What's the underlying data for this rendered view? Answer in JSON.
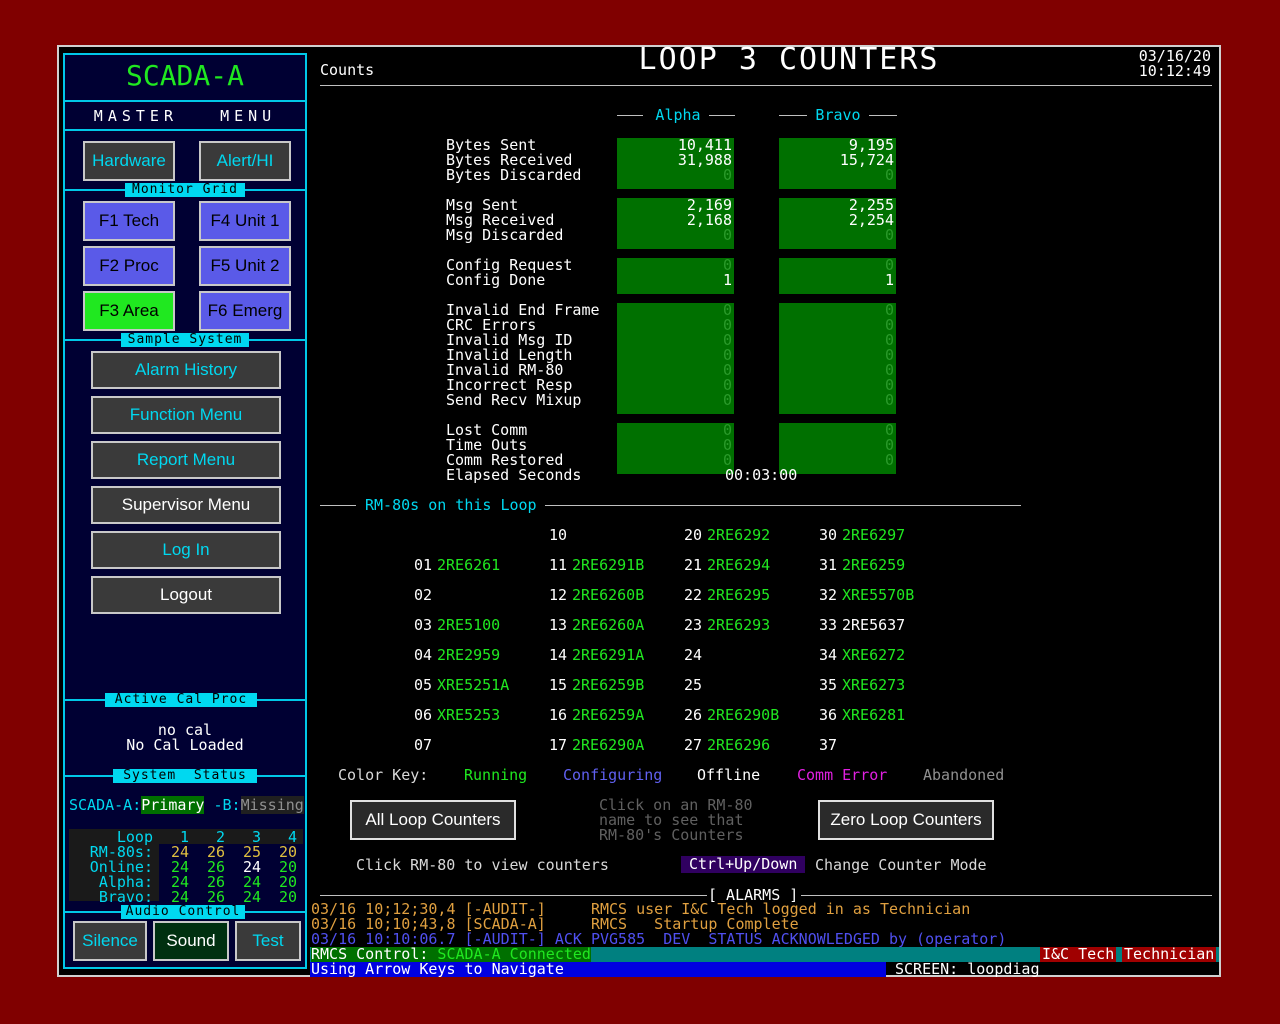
{
  "sidebar": {
    "app_title": "SCADA-A",
    "master_menu": "MASTER   MENU",
    "hardware": "Hardware",
    "alert": "Alert/HI",
    "monitor_grid_label": "Monitor Grid",
    "monitor_buttons": [
      "F1 Tech",
      "F4 Unit 1",
      "F2 Proc",
      "F5 Unit 2",
      "F3 Area",
      "F6 Emerg"
    ],
    "sample_system_label": "Sample System",
    "menu_buttons": [
      "Alarm History",
      "Function Menu",
      "Report Menu",
      "Supervisor Menu",
      "Log In",
      "Logout"
    ],
    "active_cal_label": "Active Cal Proc",
    "cal_line1": "no cal",
    "cal_line2": "No Cal Loaded",
    "system_status_label": "System  Status",
    "status_prefix": "SCADA-A:",
    "status_primary": "Primary",
    "status_b_prefix": " -B:",
    "status_missing": "Missing",
    "loop_table": {
      "rows": [
        {
          "label": "Loop",
          "values": [
            "1",
            "2",
            "3",
            "4"
          ]
        },
        {
          "label": "RM-80s:",
          "values": [
            "24",
            "26",
            "25",
            "20"
          ]
        },
        {
          "label": "Online:",
          "values": [
            "24",
            "26",
            "24",
            "20"
          ]
        },
        {
          "label": "Alpha:",
          "values": [
            "24",
            "26",
            "24",
            "20"
          ]
        },
        {
          "label": "Bravo:",
          "values": [
            "24",
            "26",
            "24",
            "20"
          ]
        }
      ]
    },
    "audio_control_label": "Audio Control",
    "audio_buttons": [
      "Silence",
      "Sound",
      "Test"
    ]
  },
  "header": {
    "section": "Counts",
    "title": "LOOP 3 COUNTERS",
    "date": "03/16/20",
    "time": "10:12:49"
  },
  "counters": {
    "alpha_label": "Alpha",
    "bravo_label": "Bravo",
    "groups": [
      {
        "labels": [
          "Bytes Sent",
          "Bytes Received",
          "Bytes Discarded"
        ],
        "alpha": [
          "10,411",
          "31,988",
          "0"
        ],
        "bravo": [
          "9,195",
          "15,724",
          "0"
        ]
      },
      {
        "labels": [
          "Msg Sent",
          "Msg Received",
          "Msg Discarded"
        ],
        "alpha": [
          "2,169",
          "2,168",
          "0"
        ],
        "bravo": [
          "2,255",
          "2,254",
          "0"
        ]
      },
      {
        "labels": [
          "Config Request",
          "Config Done"
        ],
        "alpha": [
          "0",
          "1"
        ],
        "bravo": [
          "0",
          "1"
        ]
      },
      {
        "labels": [
          "Invalid End Frame",
          "CRC Errors",
          "Invalid Msg ID",
          "Invalid Length",
          "Invalid RM-80",
          "Incorrect Resp",
          "Send Recv Mixup"
        ],
        "alpha": [
          "0",
          "0",
          "0",
          "0",
          "0",
          "0",
          "0"
        ],
        "bravo": [
          "0",
          "0",
          "0",
          "0",
          "0",
          "0",
          "0"
        ]
      },
      {
        "labels": [
          "Lost Comm",
          "Time Outs",
          "Comm Restored"
        ],
        "alpha": [
          "0",
          "0",
          "0"
        ],
        "bravo": [
          "0",
          "0",
          "0"
        ]
      }
    ],
    "elapsed_label": "Elapsed Seconds",
    "elapsed_value": "00:03:00"
  },
  "rm80": {
    "section_label": "RM-80s on this Loop",
    "columns": [
      [
        {
          "n": "01",
          "name": "2RE6261",
          "status": "running"
        },
        {
          "n": "02",
          "name": "",
          "status": ""
        },
        {
          "n": "03",
          "name": "2RE5100",
          "status": "running"
        },
        {
          "n": "04",
          "name": "2RE2959",
          "status": "running"
        },
        {
          "n": "05",
          "name": "XRE5251A",
          "status": "running"
        },
        {
          "n": "06",
          "name": "XRE5253",
          "status": "running"
        },
        {
          "n": "07",
          "name": "",
          "status": ""
        }
      ],
      [
        {
          "n": "10",
          "name": "",
          "status": ""
        },
        {
          "n": "11",
          "name": "2RE6291B",
          "status": "running"
        },
        {
          "n": "12",
          "name": "2RE6260B",
          "status": "running"
        },
        {
          "n": "13",
          "name": "2RE6260A",
          "status": "running"
        },
        {
          "n": "14",
          "name": "2RE6291A",
          "status": "running"
        },
        {
          "n": "15",
          "name": "2RE6259B",
          "status": "running"
        },
        {
          "n": "16",
          "name": "2RE6259A",
          "status": "running"
        },
        {
          "n": "17",
          "name": "2RE6290A",
          "status": "running"
        }
      ],
      [
        {
          "n": "20",
          "name": "2RE6292",
          "status": "running"
        },
        {
          "n": "21",
          "name": "2RE6294",
          "status": "running"
        },
        {
          "n": "22",
          "name": "2RE6295",
          "status": "running"
        },
        {
          "n": "23",
          "name": "2RE6293",
          "status": "running"
        },
        {
          "n": "24",
          "name": "",
          "status": ""
        },
        {
          "n": "25",
          "name": "",
          "status": ""
        },
        {
          "n": "26",
          "name": "2RE6290B",
          "status": "running"
        },
        {
          "n": "27",
          "name": "2RE6296",
          "status": "running"
        }
      ],
      [
        {
          "n": "30",
          "name": "2RE6297",
          "status": "running"
        },
        {
          "n": "31",
          "name": "2RE6259",
          "status": "running"
        },
        {
          "n": "32",
          "name": "XRE5570B",
          "status": "running"
        },
        {
          "n": "33",
          "name": "2RE5637",
          "status": "offline"
        },
        {
          "n": "34",
          "name": "XRE6272",
          "status": "running"
        },
        {
          "n": "35",
          "name": "XRE6273",
          "status": "running"
        },
        {
          "n": "36",
          "name": "XRE6281",
          "status": "running"
        },
        {
          "n": "37",
          "name": "",
          "status": ""
        }
      ]
    ],
    "color_key_label": "Color Key:",
    "color_key": [
      {
        "label": "Running",
        "color": "#20e820"
      },
      {
        "label": "Configuring",
        "color": "#6060f0"
      },
      {
        "label": "Offline",
        "color": "#ffffff"
      },
      {
        "label": "Comm Error",
        "color": "#e020e0"
      },
      {
        "label": "Abandoned",
        "color": "#909090"
      }
    ]
  },
  "actions": {
    "all_loop": "All Loop Counters",
    "zero_loop": "Zero Loop Counters",
    "hint1": "Click on an RM-80",
    "hint2": "name to see that",
    "hint3": "RM-80's Counters",
    "click_hint": "Click RM-80 to view counters",
    "ctrl_label": "Ctrl+Up/Down",
    "change_mode": "Change Counter Mode"
  },
  "alarms": {
    "title": "[ ALARMS ]",
    "lines": [
      {
        "text": "03/16 10;12;30,4 [-AUDIT-]     RMCS user I&C Tech logged in as Technician",
        "color": "#e0a040"
      },
      {
        "text": "03/16 10;10;43,8 [SCADA-A]     RMCS   Startup Complete",
        "color": "#e0a040"
      },
      {
        "text": "03/16 10:10:06.7 [-AUDIT-] ACK PVG585  DEV  STATUS ACKNOWLEDGED by (operator)",
        "color": "#5050f0"
      }
    ]
  },
  "statusbar": {
    "rmcs_label": "RMCS Control:",
    "rmcs_value": " SCADA-A Connected",
    "user": "I&C Tech",
    "role": "Technician",
    "nav_hint": "Using Arrow Keys to Navigate",
    "screen": "SCREEN: loopdiag"
  }
}
